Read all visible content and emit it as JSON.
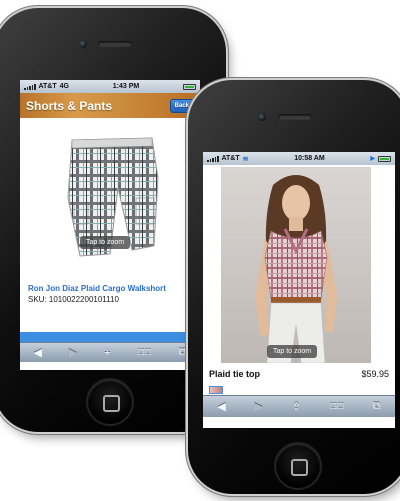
{
  "back_phone": {
    "status": {
      "carrier": "AT&T",
      "network": "4G",
      "time": "1:43 PM"
    },
    "header": {
      "title": "Shorts & Pants",
      "back_label": "Back"
    },
    "product": {
      "zoom_label": "Tap to zoom",
      "title": "Ron Jon Diaz Plaid Cargo Walkshort",
      "sku": "SKU: 1010022200101110"
    },
    "toolbar": {
      "back": "◀",
      "forward": "▶",
      "add": "+",
      "bookmarks": "☐☐",
      "tabs": "⧉"
    }
  },
  "front_phone": {
    "status": {
      "carrier": "AT&T",
      "time": "10:58 AM"
    },
    "product": {
      "zoom_label": "Tap to zoom",
      "name": "Plaid tie top",
      "price": "$59.95"
    },
    "toolbar": {
      "back": "◀",
      "forward": "▶",
      "share": "⇪",
      "bookmarks": "☐☐",
      "tabs": "⧉"
    }
  },
  "colors": {
    "accent_blue": "#2a6fd0",
    "header_brown": "#c98a3a",
    "bezel": "#0b0b0b"
  }
}
